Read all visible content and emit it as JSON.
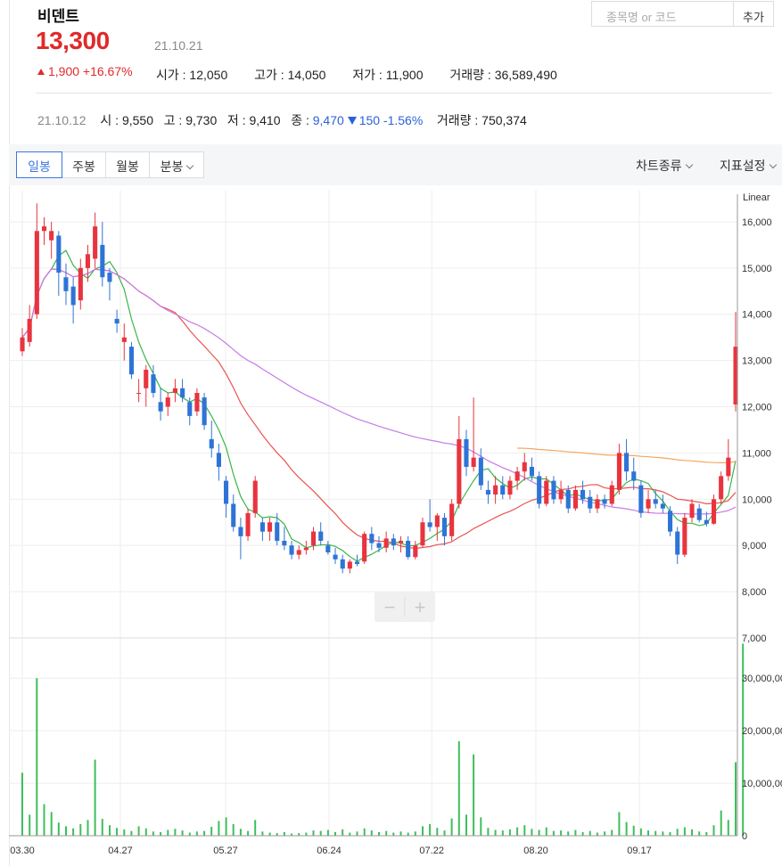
{
  "stock": {
    "name": "비덴트",
    "price": "13,300",
    "date": "21.10.21",
    "change": "1,900 +16.67%",
    "open": "시가 : 12,050",
    "high": "고가 : 14,050",
    "low": "저가 : 11,900",
    "volume": "거래량 : 36,589,490"
  },
  "search": {
    "placeholder": "종목명 or 코드",
    "add_label": "추가"
  },
  "prev_day": {
    "date": "21.10.12",
    "open": "시 : 9,550",
    "high": "고 : 9,730",
    "low": "저 : 9,410",
    "close_label": "종 : ",
    "close": "9,470",
    "change": "150 -1.56%",
    "volume": "거래량 : 750,374"
  },
  "toolbar": {
    "tabs": [
      "일봉",
      "주봉",
      "월봉",
      "분봉"
    ],
    "active_tab": "일봉",
    "chart_type": "차트종류",
    "indicator": "지표설정"
  },
  "colors": {
    "up": "#e8343f",
    "down": "#2e74d6",
    "volume": "#3dbf5b",
    "ma5": "#3cb44b",
    "ma20": "#e8544f",
    "ma60": "#c67ce8",
    "ma120": "#f5a65b"
  },
  "chart_data": {
    "type": "candlestick",
    "scale_label": "Linear",
    "price_axis": {
      "ylim": [
        7000,
        16500
      ],
      "ticks": [
        "16,000",
        "15,000",
        "14,000",
        "13,000",
        "12,000",
        "11,000",
        "10,000",
        "9,000",
        "8,000",
        "7,000"
      ]
    },
    "volume_axis": {
      "ylim": [
        0,
        37000000
      ],
      "ticks": [
        "30,000,00",
        "20,000,00",
        "10,000,00",
        "0"
      ]
    },
    "x_ticks": [
      "03.30",
      "04.27",
      "05.27",
      "06.24",
      "07.22",
      "08.20",
      "09.17"
    ],
    "zoom_controls": [
      "−",
      "+"
    ],
    "series": [
      {
        "name": "price",
        "values": [
          [
            13200,
            13700,
            13100,
            13500
          ],
          [
            13400,
            14200,
            13300,
            13900
          ],
          [
            14000,
            16400,
            13900,
            15800
          ],
          [
            15800,
            16100,
            15500,
            15900
          ],
          [
            15600,
            16000,
            15200,
            15800
          ],
          [
            15700,
            15800,
            14400,
            14900
          ],
          [
            14800,
            15100,
            14200,
            14500
          ],
          [
            14600,
            14800,
            13800,
            14200
          ],
          [
            14300,
            15200,
            14100,
            15000
          ],
          [
            15000,
            15500,
            14700,
            15300
          ],
          [
            15200,
            16200,
            15000,
            15900
          ],
          [
            15500,
            16000,
            14600,
            14800
          ],
          [
            14900,
            15000,
            14300,
            14700
          ],
          [
            13900,
            14100,
            13600,
            13800
          ],
          [
            13400,
            13800,
            13000,
            13500
          ],
          [
            13300,
            13400,
            12600,
            12700
          ],
          [
            12300,
            12600,
            12100,
            12300
          ],
          [
            12400,
            12900,
            12000,
            12800
          ],
          [
            12700,
            12900,
            12200,
            12300
          ],
          [
            12100,
            12400,
            11700,
            11900
          ],
          [
            12000,
            12300,
            11800,
            12200
          ],
          [
            12300,
            12600,
            12100,
            12400
          ],
          [
            12400,
            12600,
            12100,
            12200
          ],
          [
            12100,
            12200,
            11600,
            11800
          ],
          [
            11900,
            12400,
            11800,
            12300
          ],
          [
            12200,
            12300,
            11500,
            11600
          ],
          [
            11300,
            11700,
            10900,
            11100
          ],
          [
            11000,
            11200,
            10400,
            10700
          ],
          [
            10400,
            10500,
            9600,
            9900
          ],
          [
            9900,
            10100,
            9300,
            9400
          ],
          [
            9400,
            9600,
            8700,
            9200
          ],
          [
            9200,
            9800,
            9100,
            9700
          ],
          [
            9700,
            10500,
            9600,
            10400
          ],
          [
            9500,
            9600,
            9100,
            9300
          ],
          [
            9300,
            9600,
            9100,
            9500
          ],
          [
            9500,
            9700,
            9000,
            9100
          ],
          [
            9100,
            9400,
            8900,
            9000
          ],
          [
            9000,
            9100,
            8700,
            8800
          ],
          [
            8800,
            9000,
            8700,
            8900
          ],
          [
            8900,
            9100,
            8800,
            8950
          ],
          [
            9000,
            9400,
            8900,
            9300
          ],
          [
            9300,
            9500,
            9000,
            9100
          ],
          [
            9000,
            9100,
            8800,
            8850
          ],
          [
            8800,
            8950,
            8600,
            8700
          ],
          [
            8700,
            8800,
            8400,
            8500
          ],
          [
            8500,
            8700,
            8400,
            8650
          ],
          [
            8650,
            8800,
            8550,
            8600
          ],
          [
            8650,
            9300,
            8600,
            9250
          ],
          [
            9250,
            9400,
            8900,
            9050
          ],
          [
            9050,
            9200,
            8850,
            8950
          ],
          [
            8950,
            9300,
            8850,
            9150
          ],
          [
            9150,
            9250,
            8900,
            9000
          ],
          [
            9050,
            9200,
            8850,
            9100
          ],
          [
            9100,
            9200,
            8700,
            8750
          ],
          [
            8750,
            9100,
            8700,
            9000
          ],
          [
            9000,
            9600,
            8950,
            9500
          ],
          [
            9500,
            10000,
            9300,
            9400
          ],
          [
            9400,
            9700,
            9100,
            9650
          ],
          [
            9600,
            9700,
            9000,
            9200
          ],
          [
            9200,
            10000,
            9100,
            9900
          ],
          [
            9900,
            11800,
            9800,
            11300
          ],
          [
            11300,
            11500,
            10500,
            10700
          ],
          [
            10700,
            12200,
            10600,
            10900
          ],
          [
            10900,
            11100,
            10200,
            10300
          ],
          [
            10200,
            10400,
            9900,
            10100
          ],
          [
            10100,
            10500,
            9900,
            10300
          ],
          [
            10300,
            10500,
            10000,
            10100
          ],
          [
            10100,
            10500,
            10000,
            10400
          ],
          [
            10400,
            10700,
            10200,
            10600
          ],
          [
            10600,
            11000,
            10400,
            10800
          ],
          [
            10700,
            10900,
            10400,
            10500
          ],
          [
            10500,
            10600,
            9800,
            9900
          ],
          [
            9900,
            10500,
            9850,
            10400
          ],
          [
            10400,
            10500,
            9900,
            10000
          ],
          [
            10000,
            10400,
            9900,
            10200
          ],
          [
            10200,
            10300,
            9700,
            9800
          ],
          [
            9800,
            10300,
            9750,
            10200
          ],
          [
            10200,
            10400,
            9900,
            10000
          ],
          [
            10050,
            10200,
            9700,
            9800
          ],
          [
            9800,
            10100,
            9700,
            10000
          ],
          [
            10000,
            10100,
            9800,
            9900
          ],
          [
            9900,
            10400,
            9850,
            10300
          ],
          [
            10200,
            11200,
            10100,
            11000
          ],
          [
            11000,
            11300,
            10400,
            10600
          ],
          [
            10600,
            10900,
            10200,
            10400
          ],
          [
            10300,
            10400,
            9600,
            9700
          ],
          [
            9800,
            10200,
            9700,
            10000
          ],
          [
            10000,
            10200,
            9800,
            9900
          ],
          [
            9900,
            10100,
            9700,
            9800
          ],
          [
            9750,
            9850,
            9200,
            9300
          ],
          [
            9300,
            9400,
            8600,
            8800
          ],
          [
            8800,
            9700,
            8750,
            9600
          ],
          [
            9600,
            10000,
            9500,
            9900
          ],
          [
            9800,
            9900,
            9500,
            9550
          ],
          [
            9550,
            9730,
            9410,
            9470
          ],
          [
            9470,
            10100,
            9450,
            10000
          ],
          [
            10000,
            10600,
            9900,
            10500
          ],
          [
            10500,
            11300,
            10400,
            10900
          ],
          [
            12050,
            14050,
            11900,
            13300
          ]
        ]
      },
      {
        "name": "volume",
        "values": [
          12000000,
          4000000,
          30000000,
          6000000,
          4500000,
          2500000,
          1800000,
          1400000,
          2200000,
          3000000,
          14500000,
          3200000,
          2000000,
          1500000,
          1200000,
          900000,
          1800000,
          1400000,
          800000,
          700000,
          1100000,
          1300000,
          1000000,
          600000,
          800000,
          900000,
          1700000,
          2800000,
          3500000,
          2200000,
          1300000,
          900000,
          3000000,
          800000,
          600000,
          500000,
          700000,
          400000,
          500000,
          600000,
          1000000,
          900000,
          1100000,
          700000,
          1200000,
          600000,
          800000,
          1400000,
          1000000,
          700000,
          900000,
          600000,
          800000,
          600000,
          800000,
          1800000,
          2200000,
          1500000,
          1000000,
          3300000,
          18000000,
          4000000,
          15500000,
          3500000,
          1500000,
          1100000,
          1000000,
          1200000,
          1600000,
          2000000,
          1300000,
          1100000,
          1600000,
          900000,
          1000000,
          800000,
          1100000,
          700000,
          900000,
          600000,
          800000,
          1100000,
          4500000,
          2600000,
          1900000,
          1400000,
          1000000,
          900000,
          800000,
          700000,
          1300000,
          1600000,
          1200000,
          800000,
          700000,
          2000000,
          4800000,
          3000000,
          14000000,
          36589490
        ]
      }
    ]
  }
}
